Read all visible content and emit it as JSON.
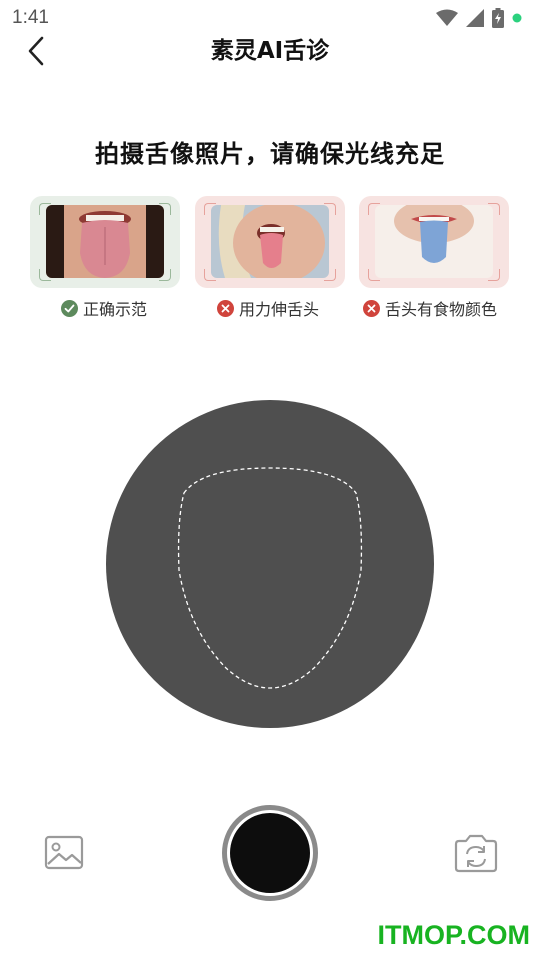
{
  "status_bar": {
    "time": "1:41"
  },
  "header": {
    "title": "素灵AI舌诊"
  },
  "instruction": "拍摄舌像照片，请确保光线充足",
  "examples": [
    {
      "caption": "正确示范",
      "status": "correct",
      "photo": "tongue-correct-example"
    },
    {
      "caption": "用力伸舌头",
      "status": "wrong",
      "photo": "tongue-overextended-example"
    },
    {
      "caption": "舌头有食物颜色",
      "status": "wrong",
      "photo": "tongue-food-stained-example"
    }
  ],
  "colors": {
    "correct": "#5d8a5d",
    "wrong": "#d0443c",
    "preview": "#4f4f4f",
    "watermark": "#18b321"
  },
  "icons": {
    "back": "chevron-left-icon",
    "gallery": "image-icon",
    "switch_camera": "camera-switch-icon"
  },
  "watermark": "ITMOP.COM"
}
